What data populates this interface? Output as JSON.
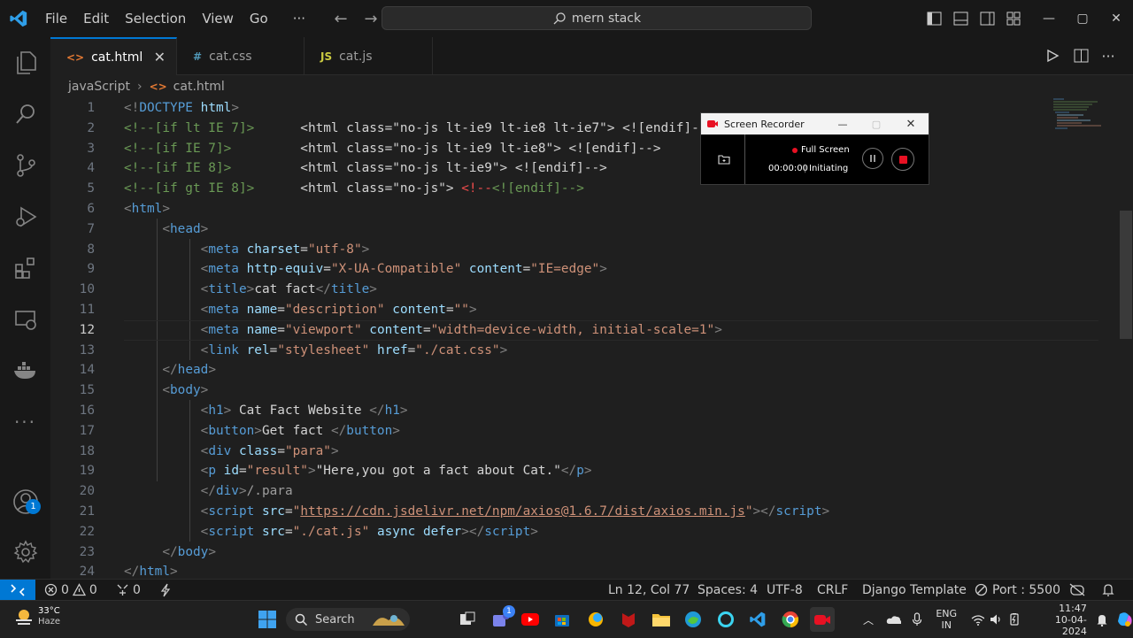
{
  "menu": [
    "File",
    "Edit",
    "Selection",
    "View",
    "Go",
    "···"
  ],
  "search": {
    "text": "mern stack"
  },
  "tabs": [
    {
      "icon": "<>",
      "label": "cat.html",
      "close": "✕"
    },
    {
      "icon": "#",
      "label": "cat.css"
    },
    {
      "icon": "JS",
      "label": "cat.js"
    }
  ],
  "breadcrumb": {
    "folder": "javaScript",
    "sep": "›",
    "file_icon": "<>",
    "file": "cat.html"
  },
  "account_badge": "1",
  "code": {
    "numbers": [
      "1",
      "2",
      "3",
      "4",
      "5",
      "6",
      "7",
      "8",
      "9",
      "10",
      "11",
      "12",
      "13",
      "14",
      "15",
      "16",
      "17",
      "18",
      "19",
      "20",
      "21",
      "22",
      "23",
      "24"
    ],
    "current_line": "12"
  },
  "recorder": {
    "title": "Screen Recorder",
    "mode": "Full Screen",
    "time": "00:00:00",
    "sep": "|",
    "status": "Initiating"
  },
  "statusbar": {
    "errors": "0",
    "warnings": "0",
    "ports": "0",
    "position": "Ln 12, Col 77",
    "spaces": "Spaces: 4",
    "encoding": "UTF-8",
    "eol": "CRLF",
    "language": "Django Template",
    "port": "Port : 5500"
  },
  "taskbar": {
    "weather_temp": "33°C",
    "weather_desc": "Haze",
    "search": "Search",
    "teams_badge": "1",
    "lang1": "ENG",
    "lang2": "IN",
    "time": "11:47",
    "date": "10-04-2024"
  }
}
